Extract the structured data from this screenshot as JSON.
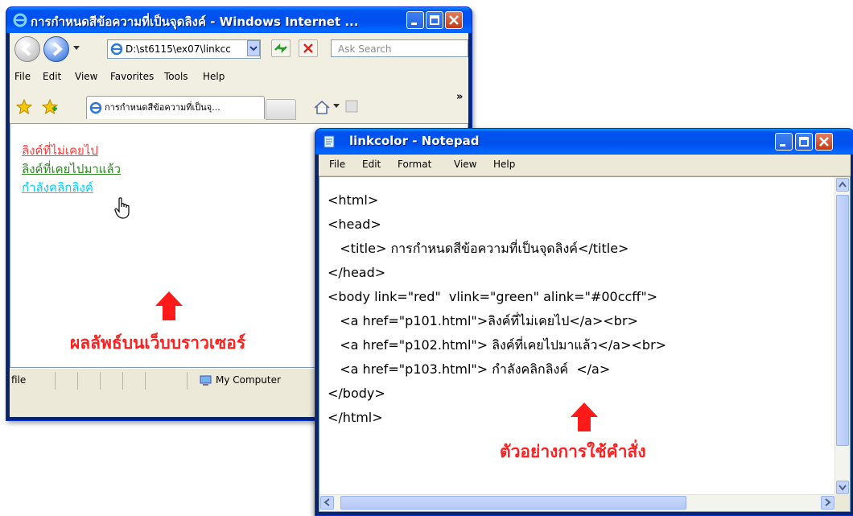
{
  "ie": {
    "title": "การกำหนดสีข้อความที่เป็นจุดลิงค์ - Windows Internet ...",
    "address": "D:\\st6115\\ex07\\linkcc",
    "search_placeholder": "Ask Search",
    "menu": [
      "File",
      "Edit",
      "View",
      "Favorites",
      "Tools",
      "Help"
    ],
    "tab_title": "การกำหนดสีข้อความที่เป็นจุ...",
    "links": [
      {
        "text": "ลิงค์ที่ไม่เคยไป",
        "color": "#ff3b3b"
      },
      {
        "text": "ลิงค์ที่เคยไปมาแล้ว",
        "color": "#2e8b22"
      },
      {
        "text": "กำลังคลิกลิงค์",
        "color": "#00ccff"
      }
    ],
    "status_left": "file",
    "status_zone": "My Computer",
    "chevron": "»"
  },
  "notepad": {
    "title": "linkcolor - Notepad",
    "menu": [
      "File",
      "Edit",
      "Format",
      "View",
      "Help"
    ],
    "lines": [
      "<html>",
      "<head>",
      "   <title> การกำหนดสีข้อความที่เป็นจุดลิงค์</title>",
      "</head>",
      "<body link=\"red\"  vlink=\"green\" alink=\"#00ccff\">",
      "   <a href=\"p101.html\">ลิงค์ที่ไม่เคยไป</a><br>",
      "   <a href=\"p102.html\"> ลิงค์ที่เคยไปมาแล้ว</a><br>",
      "   <a href=\"p103.html\"> กำลังคลิกลิงค์  </a>",
      "</body>",
      "</html>"
    ]
  },
  "annotations": {
    "browser_result": "ผลลัพธ์บนเว็บบราวเซอร์",
    "command_example": "ตัวอย่างการใช้คำสั่ง",
    "color": "#ff1f1f"
  }
}
